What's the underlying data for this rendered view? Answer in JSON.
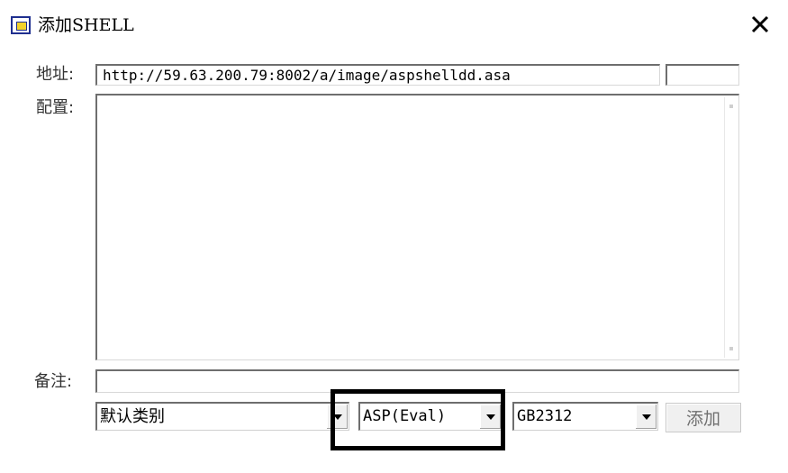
{
  "window": {
    "title": "添加SHELL",
    "close_symbol": "✕",
    "icon": "window-icon"
  },
  "form": {
    "address_label": "地址:",
    "address_value": "http://59.63.200.79:8002/a/image/aspshelldd.asa",
    "password_value": "",
    "config_label": "配置:",
    "config_value": "",
    "note_label": "备注:",
    "note_value": ""
  },
  "selects": {
    "category": "默认类别",
    "script_type": "ASP(Eval)",
    "encoding": "GB2312"
  },
  "buttons": {
    "add_label": "添加"
  },
  "annotation": {
    "highlight_color": "#000000"
  }
}
